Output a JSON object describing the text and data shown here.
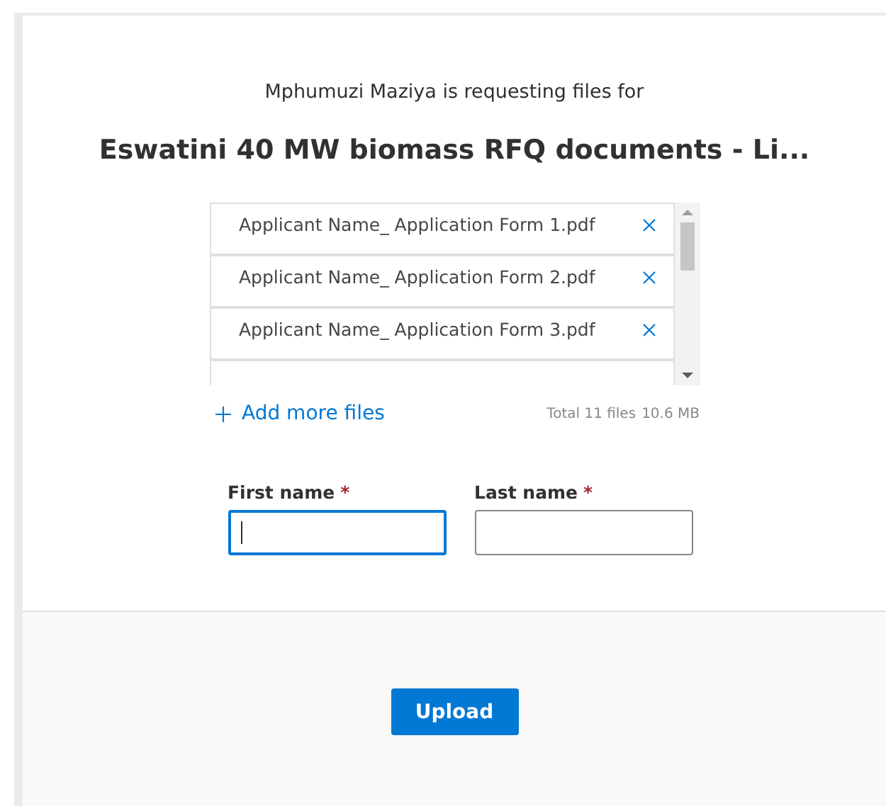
{
  "request": {
    "subtitle": "Mphumuzi Maziya is requesting files for",
    "title": "Eswatini 40 MW biomass RFQ documents - Li..."
  },
  "files": [
    {
      "name": "Applicant Name_ Application Form 1.pdf"
    },
    {
      "name": "Applicant Name_ Application Form 2.pdf"
    },
    {
      "name": "Applicant Name_ Application Form 3.pdf"
    }
  ],
  "add_more": "Add more files",
  "total": "Total 11 files",
  "size": "10.6 MB",
  "fields": [
    {
      "label": "First name",
      "required_mark": "*",
      "focused": true
    },
    {
      "label": "Last name",
      "required_mark": "*",
      "focused": false
    }
  ],
  "button": "Upload"
}
